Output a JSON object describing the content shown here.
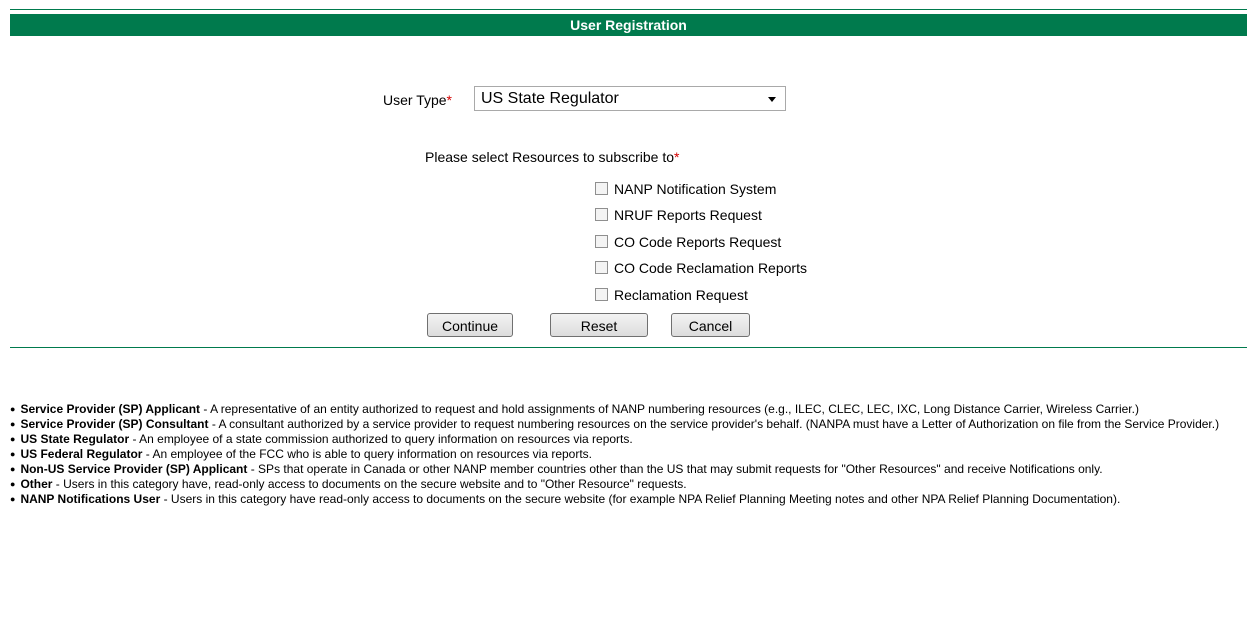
{
  "header": {
    "title": "User Registration"
  },
  "form": {
    "user_type_label": "User Type",
    "required_marker": "*",
    "user_type_value": "US State Regulator",
    "resources_prompt": "Please select Resources to subscribe to",
    "resources": [
      {
        "label": "NANP Notification System",
        "checked": false
      },
      {
        "label": "NRUF Reports Request",
        "checked": false
      },
      {
        "label": "CO Code Reports Request",
        "checked": false
      },
      {
        "label": "CO Code Reclamation Reports",
        "checked": false
      },
      {
        "label": "Reclamation Request",
        "checked": false
      }
    ],
    "buttons": {
      "continue": "Continue",
      "reset": "Reset",
      "cancel": "Cancel"
    }
  },
  "definitions": [
    {
      "term": "Service Provider (SP) Applicant",
      "text": " - A representative of an entity authorized to request and hold assignments of NANP numbering resources (e.g., ILEC, CLEC, LEC, IXC, Long Distance Carrier, Wireless Carrier.)"
    },
    {
      "term": "Service Provider (SP) Consultant",
      "text": " - A consultant authorized by a service provider to request numbering resources on the service provider's behalf. (NANPA must have a Letter of Authorization on file from the Service Provider.)"
    },
    {
      "term": "US State Regulator",
      "text": " - An employee of a state commission authorized to query information on resources via reports."
    },
    {
      "term": "US Federal Regulator",
      "text": " - An employee of the FCC who is able to query information on resources via reports."
    },
    {
      "term": "Non-US Service Provider (SP) Applicant",
      "text": " - SPs that operate in Canada or other NANP member countries other than the US that may submit requests for \"Other Resources\" and receive Notifications only."
    },
    {
      "term": "Other",
      "text": " - Users in this category have, read-only access to documents on the secure website and to \"Other Resource\" requests."
    },
    {
      "term": "NANP Notifications User",
      "text": " - Users in this category have read-only access to documents on the secure website (for example NPA Relief Planning Meeting notes and other NPA Relief Planning Documentation)."
    }
  ],
  "colors": {
    "brand_green": "#007a4d",
    "required_red": "#d40000"
  }
}
